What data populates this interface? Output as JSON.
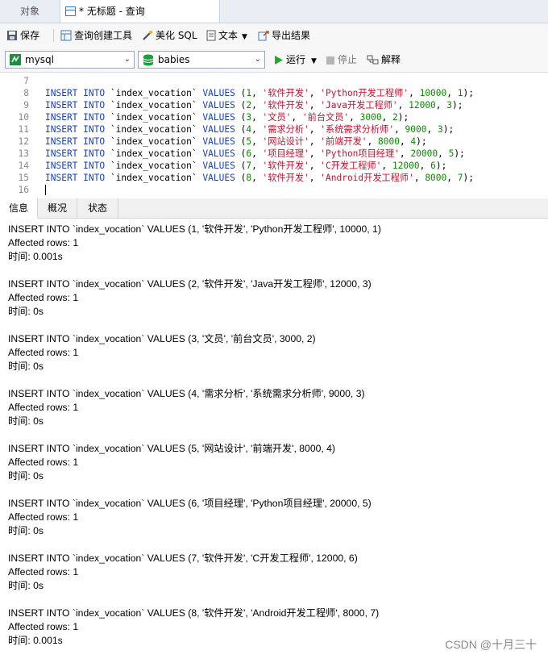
{
  "tabs": {
    "objects": "对象",
    "query": "* 无标题 - 查询"
  },
  "toolbar": {
    "save": "保存",
    "query_builder": "查询创建工具",
    "beautify": "美化 SQL",
    "text": "文本",
    "export": "导出结果"
  },
  "connection": {
    "server": "mysql",
    "database": "babies",
    "run": "运行",
    "stop": "停止",
    "explain": "解释"
  },
  "editor": {
    "lines": [
      {
        "n": "7",
        "id": "",
        "cat": "",
        "job": "",
        "sal": "",
        "x": ""
      },
      {
        "n": "8",
        "id": "1",
        "cat": "'软件开发'",
        "job": "'Python开发工程师'",
        "sal": "10000",
        "x": "1"
      },
      {
        "n": "9",
        "id": "2",
        "cat": "'软件开发'",
        "job": "'Java开发工程师'",
        "sal": "12000",
        "x": "3"
      },
      {
        "n": "10",
        "id": "3",
        "cat": "'文员'",
        "job": "'前台文员'",
        "sal": "3000",
        "x": "2"
      },
      {
        "n": "11",
        "id": "4",
        "cat": "'需求分析'",
        "job": "'系统需求分析师'",
        "sal": "9000",
        "x": "3"
      },
      {
        "n": "12",
        "id": "5",
        "cat": "'网站设计'",
        "job": "'前端开发'",
        "sal": "8000",
        "x": "4"
      },
      {
        "n": "13",
        "id": "6",
        "cat": "'项目经理'",
        "job": "'Python项目经理'",
        "sal": "20000",
        "x": "5"
      },
      {
        "n": "14",
        "id": "7",
        "cat": "'软件开发'",
        "job": "'C开发工程师'",
        "sal": "12000",
        "x": "6"
      },
      {
        "n": "15",
        "id": "8",
        "cat": "'软件开发'",
        "job": "'Android开发工程师'",
        "sal": "8000",
        "x": "7"
      },
      {
        "n": "16",
        "id": "",
        "cat": "",
        "job": "",
        "sal": "",
        "x": ""
      }
    ],
    "insert_kw": "INSERT",
    "into_kw": "INTO",
    "table": "`index_vocation`",
    "values_kw": "VALUES"
  },
  "result_tabs": [
    "信息",
    "概况",
    "状态"
  ],
  "results": [
    {
      "sql": "INSERT INTO `index_vocation` VALUES (1, '软件开发', 'Python开发工程师', 10000, 1)",
      "affected": "Affected rows: 1",
      "time": "时间: 0.001s"
    },
    {
      "sql": "INSERT INTO `index_vocation` VALUES (2, '软件开发', 'Java开发工程师', 12000, 3)",
      "affected": "Affected rows: 1",
      "time": "时间: 0s"
    },
    {
      "sql": "INSERT INTO `index_vocation` VALUES (3, '文员', '前台文员', 3000, 2)",
      "affected": "Affected rows: 1",
      "time": "时间: 0s"
    },
    {
      "sql": "INSERT INTO `index_vocation` VALUES (4, '需求分析', '系统需求分析师', 9000, 3)",
      "affected": "Affected rows: 1",
      "time": "时间: 0s"
    },
    {
      "sql": "INSERT INTO `index_vocation` VALUES (5, '网站设计', '前端开发', 8000, 4)",
      "affected": "Affected rows: 1",
      "time": "时间: 0s"
    },
    {
      "sql": "INSERT INTO `index_vocation` VALUES (6, '项目经理', 'Python项目经理', 20000, 5)",
      "affected": "Affected rows: 1",
      "time": "时间: 0s"
    },
    {
      "sql": "INSERT INTO `index_vocation` VALUES (7, '软件开发', 'C开发工程师', 12000, 6)",
      "affected": "Affected rows: 1",
      "time": "时间: 0s"
    },
    {
      "sql": "INSERT INTO `index_vocation` VALUES (8, '软件开发', 'Android开发工程师', 8000, 7)",
      "affected": "Affected rows: 1",
      "time": "时间: 0.001s"
    }
  ],
  "watermark": "CSDN @十月三十",
  "colors": {
    "keyword": "#1a3fbf",
    "string": "#c8102e",
    "number": "#0a8a00",
    "run": "#2aa52a"
  }
}
